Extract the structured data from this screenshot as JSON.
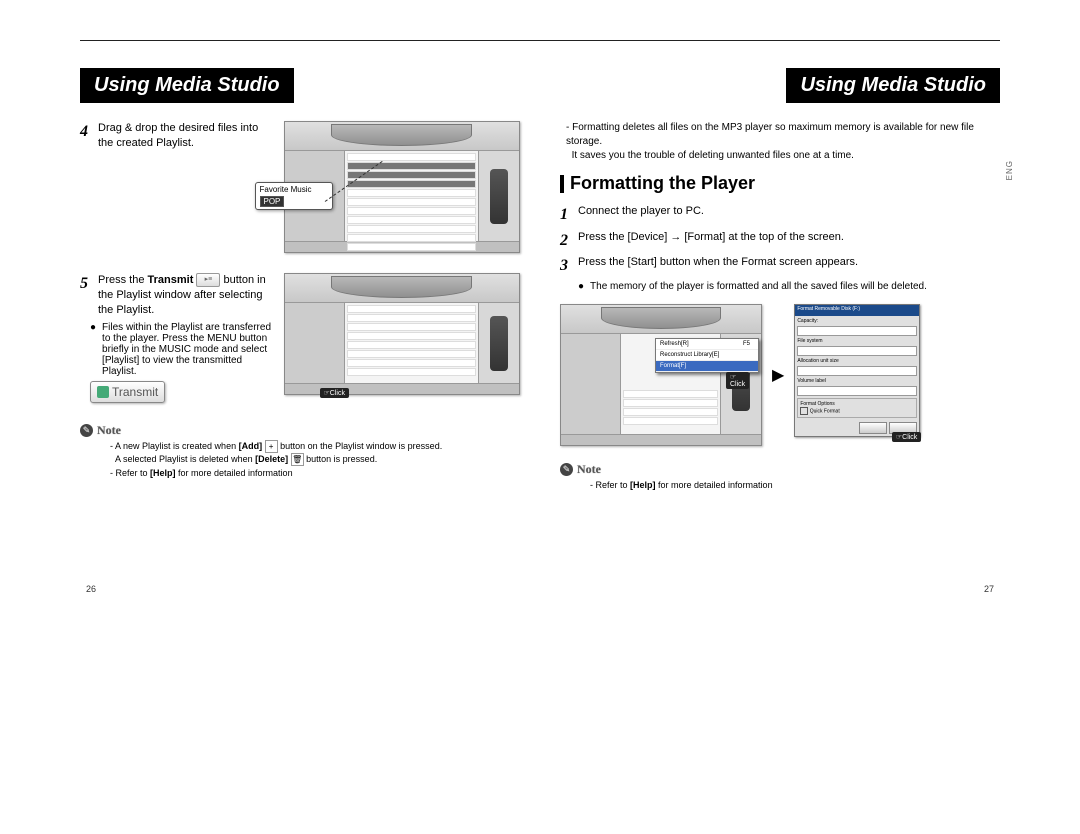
{
  "left": {
    "header": "Using Media Studio",
    "step4_num": "4",
    "step4_text": "Drag & drop the desired files into the created Playlist.",
    "callout_fav": "Favorite Music",
    "callout_pop": "POP",
    "step5_num": "5",
    "step5_pre": "Press the ",
    "step5_bold": "Transmit",
    "step5_post": " button in the Playlist window after selecting the Playlist.",
    "step5_bullet": "Files within the Playlist are transferred to the player. Press the MENU button briefly in the MUSIC mode and select [Playlist] to view the transmitted Playlist.",
    "transmit_label": "Transmit",
    "click_label": "Click",
    "note_label": "Note",
    "note1_a": "A new Playlist is created when ",
    "note1_add": "[Add]",
    "note1_b": " button on the Playlist window is pressed.",
    "note2_a": "A selected Playlist is deleted when ",
    "note2_del": "[Delete]",
    "note2_b": " button is pressed.",
    "note3_a": "Refer to ",
    "note3_help": "[Help]",
    "note3_b": " for more detailed information",
    "page_num": "26"
  },
  "right": {
    "header": "Using Media Studio",
    "intro1": "Formatting deletes all files on the MP3 player so maximum memory is available for new file storage.",
    "intro2": "It saves you the trouble of deleting unwanted files one at a time.",
    "section_title": "Formatting the Player",
    "lang": "ENG",
    "s1_num": "1",
    "s1_text": "Connect the player to PC.",
    "s2_num": "2",
    "s2_text": "Press the [Device] → [Format] at the top of the screen.",
    "s3_num": "3",
    "s3_text": "Press the [Start] button when the Format screen appears.",
    "s3_bullet": "The memory of the player is formatted and all the saved files will be deleted.",
    "ctx_refresh": "Refresh[R]",
    "ctx_f5": "F5",
    "ctx_recon": "Reconstruct Library[E]",
    "ctx_format": "Format[F]",
    "click_label": "Click",
    "dlg_title": "Format Removable Disk (F:)",
    "dlg_cap": "Capacity:",
    "dlg_fs": "File system",
    "dlg_au": "Allocation unit size",
    "dlg_vl": "Volume label",
    "dlg_fo": "Format Options",
    "dlg_qf": "Quick Format",
    "note_label": "Note",
    "note1_a": "Refer to ",
    "note1_help": "[Help]",
    "note1_b": " for more detailed information",
    "page_num": "27"
  }
}
